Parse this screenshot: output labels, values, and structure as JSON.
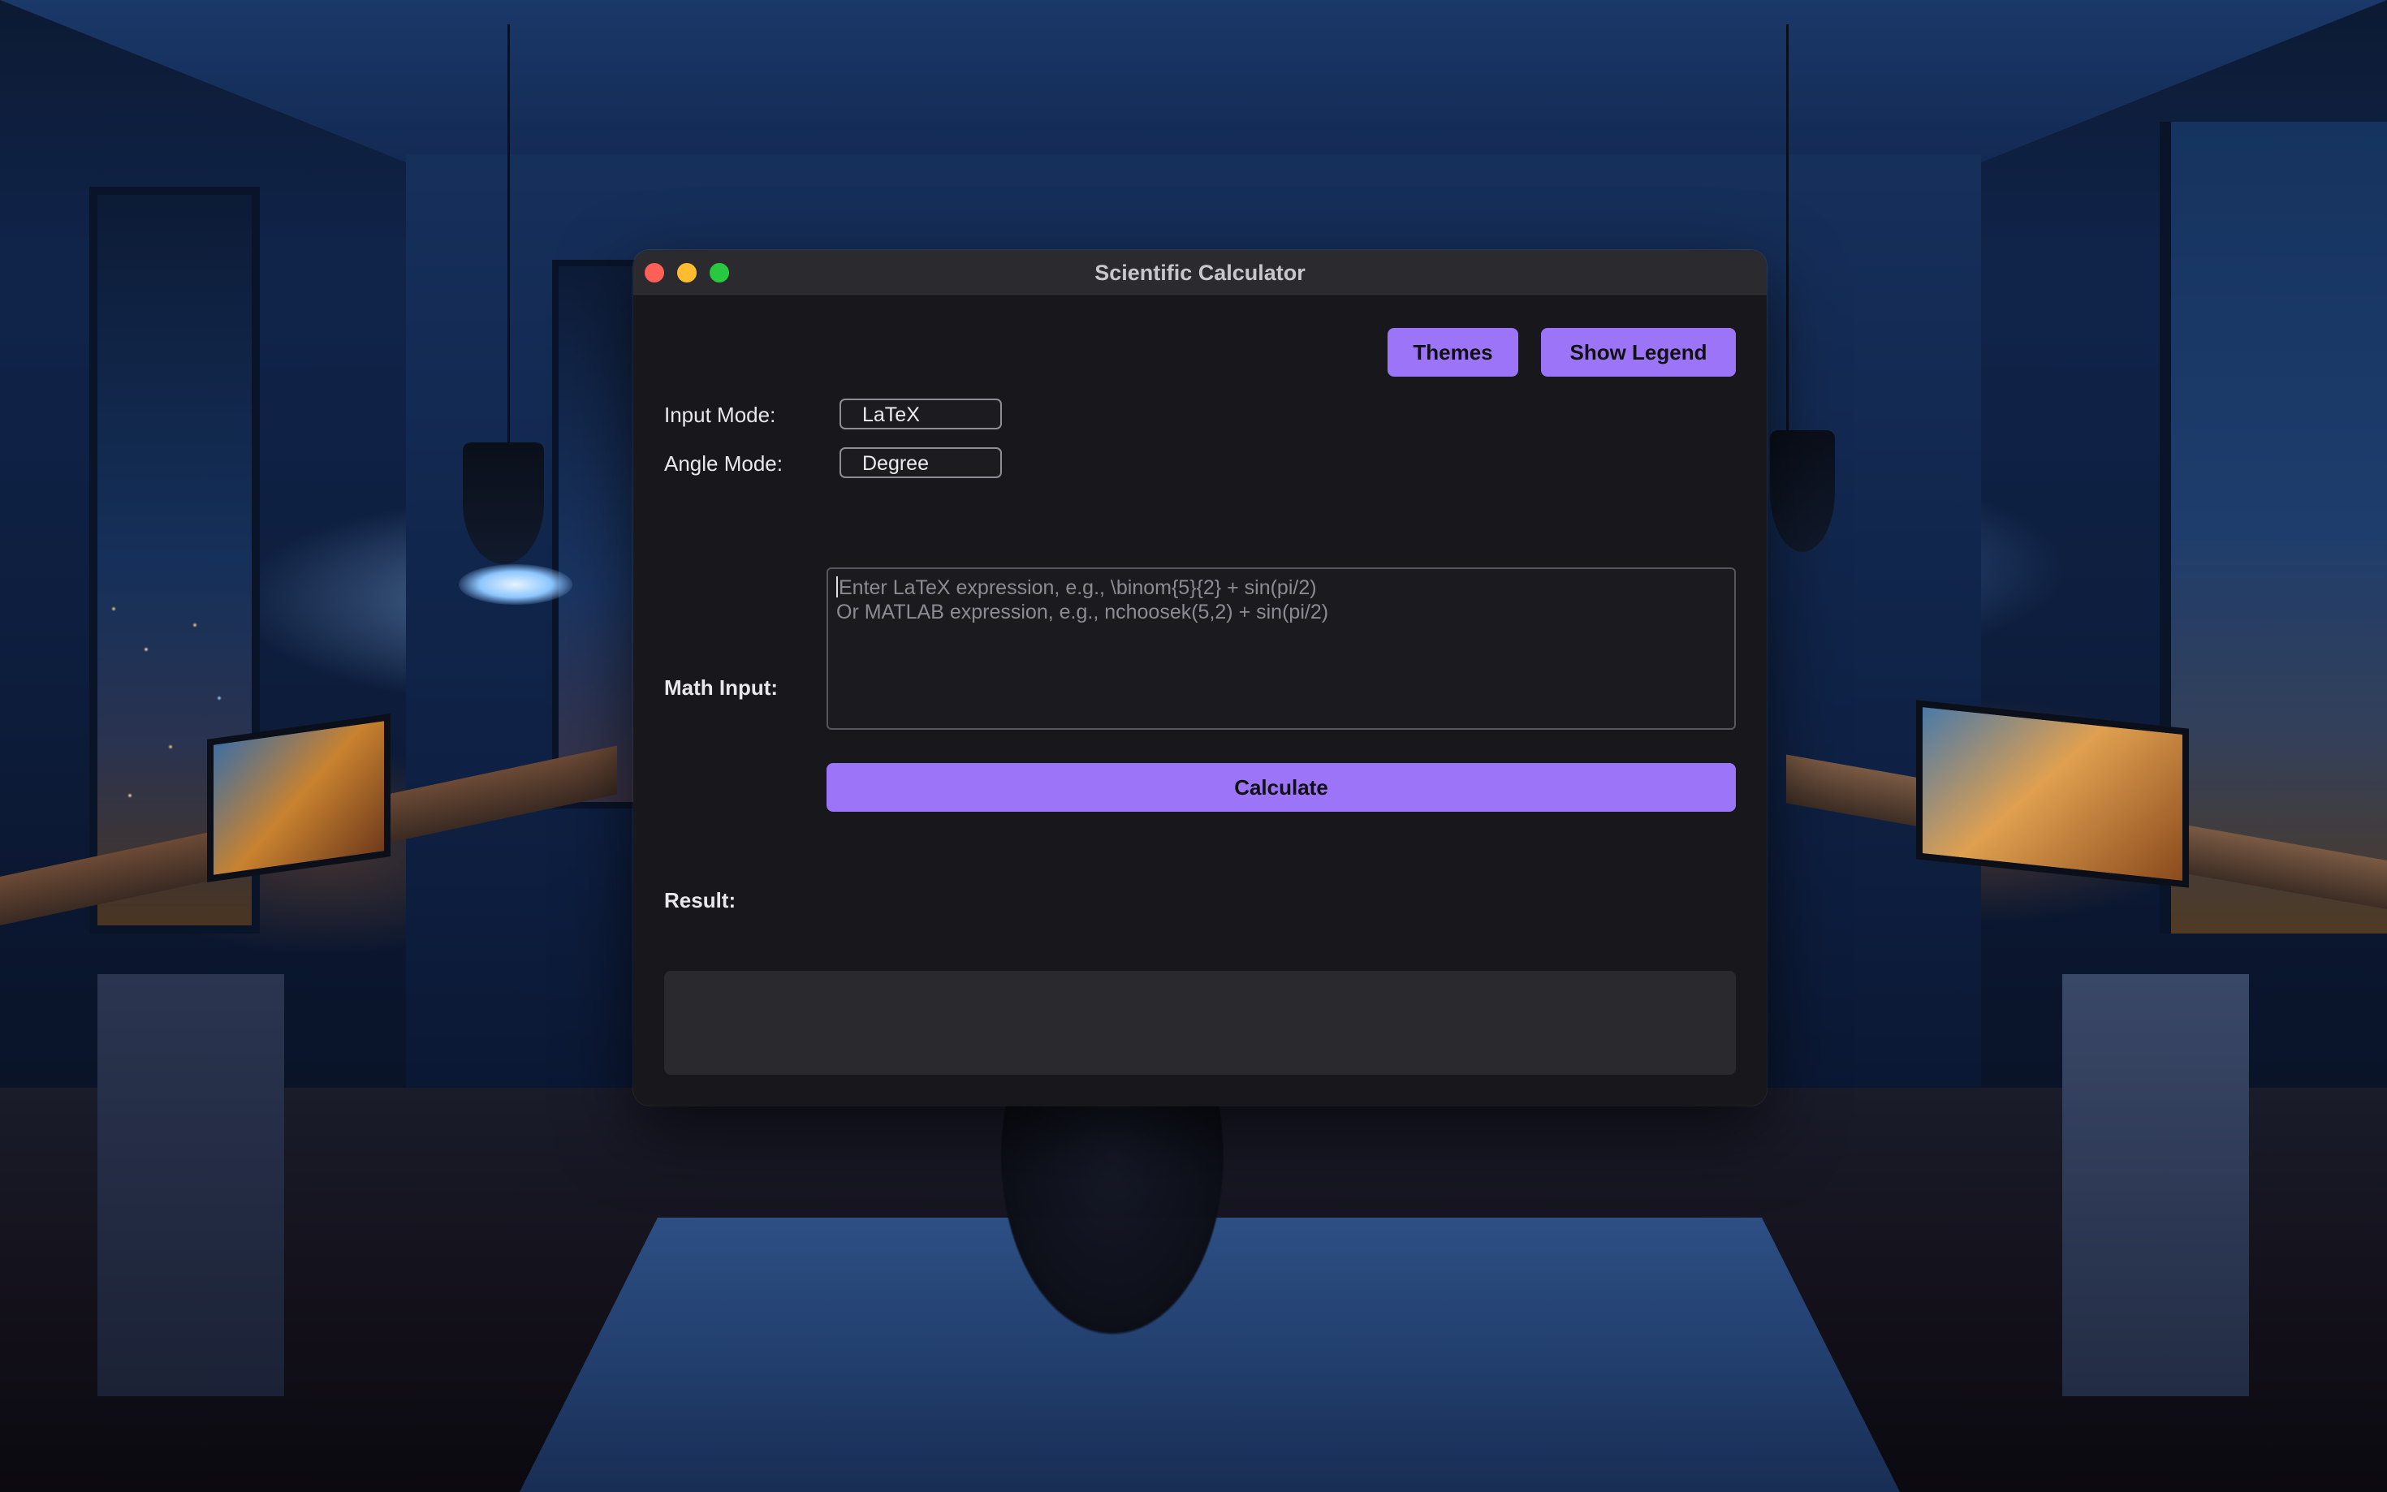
{
  "window": {
    "title": "Scientific Calculator"
  },
  "toolbar": {
    "themes_label": "Themes",
    "show_legend_label": "Show Legend"
  },
  "settings": {
    "input_mode_label": "Input Mode:",
    "input_mode_value": "LaTeX",
    "angle_mode_label": "Angle Mode:",
    "angle_mode_value": "Degree"
  },
  "math": {
    "label": "Math Input:",
    "placeholder_line1": "Enter LaTeX expression, e.g., \\binom{5}{2} + sin(pi/2)",
    "placeholder_line2": "Or MATLAB expression, e.g., nchoosek(5,2) + sin(pi/2)",
    "calculate_label": "Calculate"
  },
  "result": {
    "label": "Result:",
    "value": ""
  },
  "colors": {
    "accent": "#9b74f8",
    "window_bg": "#18181c",
    "titlebar_bg": "#2b2b2f",
    "result_bg": "#2a2a2e",
    "close": "#fe5f57",
    "minimize": "#febc2e",
    "maximize": "#28c840"
  }
}
